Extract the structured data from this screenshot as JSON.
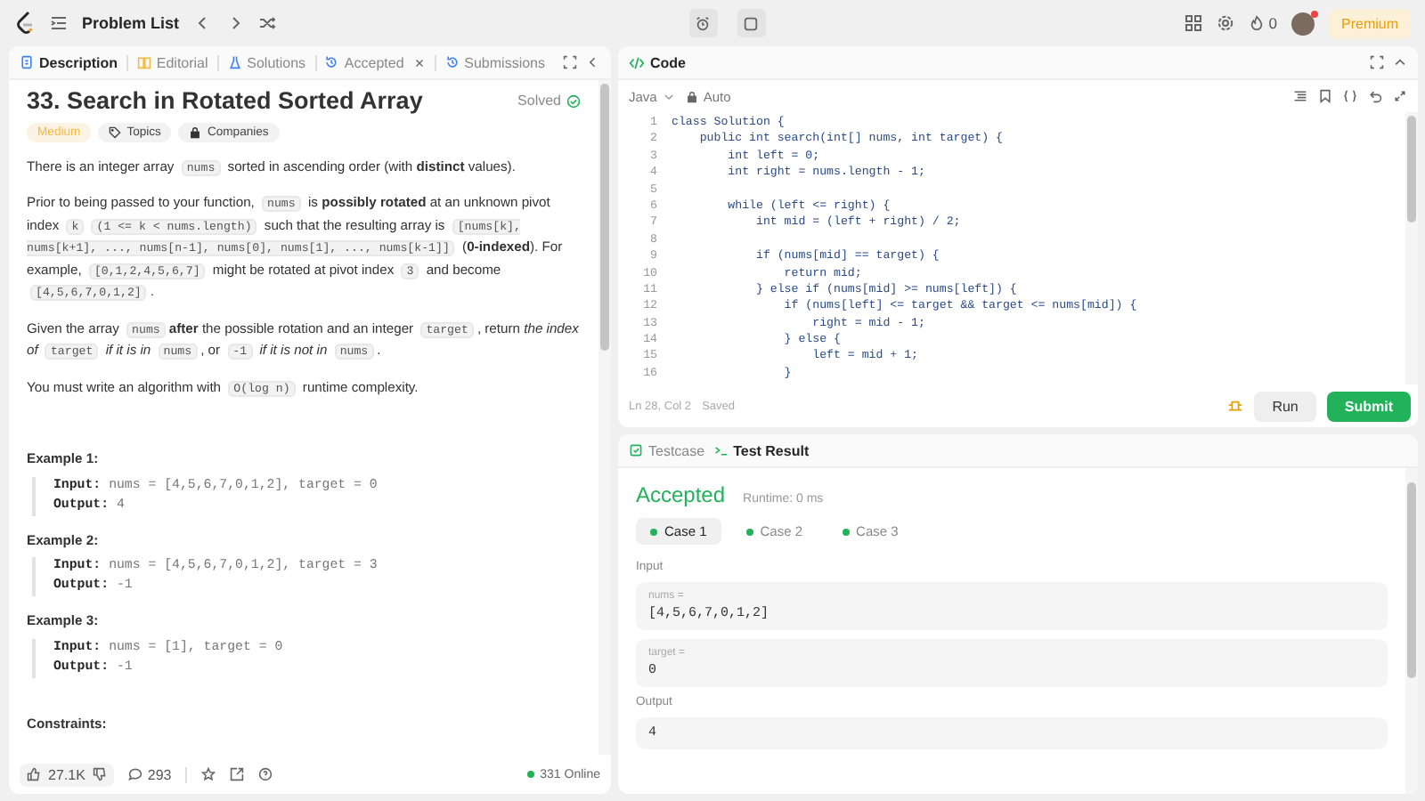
{
  "top_bar": {
    "title": "Problem List",
    "streak": "0",
    "premium": "Premium"
  },
  "left_tabs": [
    {
      "label": "Description",
      "selected": true,
      "kind": "description"
    },
    {
      "label": "Editorial",
      "selected": false,
      "kind": "editorial"
    },
    {
      "label": "Solutions",
      "selected": false,
      "kind": "solutions"
    },
    {
      "label": "Accepted",
      "selected": false,
      "kind": "accepted"
    },
    {
      "label": "Submissions",
      "selected": false,
      "kind": "submissions"
    }
  ],
  "problem": {
    "title": "33. Search in Rotated Sorted Array",
    "status": "Solved",
    "tags": [
      {
        "label": "Medium",
        "kind": "difficulty"
      },
      {
        "label": "Topics",
        "kind": "topics"
      },
      {
        "label": "Companies",
        "kind": "companies"
      }
    ],
    "paragraphs": [
      [
        {
          "kind": "text",
          "text": "There is an integer array "
        },
        {
          "kind": "code",
          "text": "nums"
        },
        {
          "kind": "text",
          "text": " sorted in ascending order (with "
        },
        {
          "kind": "bold",
          "text": "distinct"
        },
        {
          "kind": "text",
          "text": " values)."
        }
      ],
      [
        {
          "kind": "text",
          "text": "Prior to being passed to your function, "
        },
        {
          "kind": "code",
          "text": "nums"
        },
        {
          "kind": "text",
          "text": " is "
        },
        {
          "kind": "bold",
          "text": "possibly rotated"
        },
        {
          "kind": "text",
          "text": " at an unknown pivot index "
        },
        {
          "kind": "code",
          "text": "k"
        },
        {
          "kind": "code",
          "text": "(1 <= k < nums.length)"
        },
        {
          "kind": "text",
          "text": " such that the resulting array is "
        },
        {
          "kind": "code",
          "text": "[nums[k], nums[k+1], ..., nums[n-1], nums[0], nums[1], ..., nums[k-1]]"
        },
        {
          "kind": "text",
          "text": " ("
        },
        {
          "kind": "bold",
          "text": "0-indexed"
        },
        {
          "kind": "text",
          "text": "). For example, "
        },
        {
          "kind": "code",
          "text": "[0,1,2,4,5,6,7]"
        },
        {
          "kind": "text",
          "text": " might be rotated at pivot index "
        },
        {
          "kind": "code",
          "text": "3"
        },
        {
          "kind": "text",
          "text": " and become "
        },
        {
          "kind": "code",
          "text": "[4,5,6,7,0,1,2]"
        },
        {
          "kind": "text",
          "text": "."
        }
      ],
      [
        {
          "kind": "text",
          "text": "Given the array "
        },
        {
          "kind": "code",
          "text": "nums"
        },
        {
          "kind": "bold",
          "text": "after"
        },
        {
          "kind": "text",
          "text": " the possible rotation and an integer "
        },
        {
          "kind": "code",
          "text": "target"
        },
        {
          "kind": "text",
          "text": ", return "
        },
        {
          "kind": "italic",
          "text": "the index of "
        },
        {
          "kind": "code",
          "text": "target"
        },
        {
          "kind": "italic",
          "text": " if it is in "
        },
        {
          "kind": "code",
          "text": "nums"
        },
        {
          "kind": "text",
          "text": ", or "
        },
        {
          "kind": "code",
          "text": "-1"
        },
        {
          "kind": "italic",
          "text": " if it is not in "
        },
        {
          "kind": "code",
          "text": "nums"
        },
        {
          "kind": "text",
          "text": "."
        }
      ],
      [
        {
          "kind": "text",
          "text": "You must write an algorithm with "
        },
        {
          "kind": "code",
          "text": "O(log n)"
        },
        {
          "kind": "text",
          "text": " runtime complexity."
        }
      ]
    ],
    "examples": [
      {
        "heading": "Example 1:",
        "lines": [
          {
            "label": "Input:",
            "value": "nums = [4,5,6,7,0,1,2], target = 0"
          },
          {
            "label": "Output:",
            "value": "4"
          }
        ]
      },
      {
        "heading": "Example 2:",
        "lines": [
          {
            "label": "Input:",
            "value": "nums = [4,5,6,7,0,1,2], target = 3"
          },
          {
            "label": "Output:",
            "value": "-1"
          }
        ]
      },
      {
        "heading": "Example 3:",
        "lines": [
          {
            "label": "Input:",
            "value": "nums = [1], target = 0"
          },
          {
            "label": "Output:",
            "value": "-1"
          }
        ]
      }
    ],
    "constraints_heading": "Constraints:"
  },
  "footer": {
    "likes": "27.1K",
    "comments": "293",
    "online": "331 Online"
  },
  "code_panel": {
    "title": "Code",
    "language": "Java",
    "mode": "Auto",
    "lines": [
      {
        "number": "1",
        "text": "class Solution {"
      },
      {
        "number": "2",
        "text": "    public int search(int[] nums, int target) {"
      },
      {
        "number": "3",
        "text": "        int left = 0;"
      },
      {
        "number": "4",
        "text": "        int right = nums.length - 1;"
      },
      {
        "number": "5"
      },
      {
        "number": "6",
        "text": "        while (left <= right) {"
      },
      {
        "number": "7",
        "text": "            int mid = (left + right) / 2;"
      },
      {
        "number": "8"
      },
      {
        "number": "9",
        "text": "            if (nums[mid] == target) {"
      },
      {
        "number": "10",
        "text": "                return mid;"
      },
      {
        "number": "11",
        "text": "            } else if (nums[mid] >= nums[left]) {"
      },
      {
        "number": "12",
        "text": "                if (nums[left] <= target && target <= nums[mid]) {"
      },
      {
        "number": "13",
        "text": "                    right = mid - 1;"
      },
      {
        "number": "14",
        "text": "                } else {"
      },
      {
        "number": "15",
        "text": "                    left = mid + 1;"
      },
      {
        "number": "16",
        "text": "                }"
      }
    ],
    "cursor": "Ln 28, Col 2",
    "save_state": "Saved",
    "run": "Run",
    "submit": "Submit"
  },
  "result_panel": {
    "tabs": [
      {
        "label": "Testcase",
        "selected": false,
        "kind": "testcase"
      },
      {
        "label": "Test Result",
        "selected": true,
        "kind": "result"
      }
    ],
    "verdict": "Accepted",
    "runtime": "Runtime: 0 ms",
    "cases": [
      {
        "label": "Case 1",
        "selected": true
      },
      {
        "label": "Case 2",
        "selected": false
      },
      {
        "label": "Case 3",
        "selected": false
      }
    ],
    "input_label": "Input",
    "inputs": [
      {
        "label": "nums =",
        "value": "[4,5,6,7,0,1,2]"
      },
      {
        "label": "target =",
        "value": "0"
      }
    ],
    "output_label": "Output",
    "output": "4"
  }
}
